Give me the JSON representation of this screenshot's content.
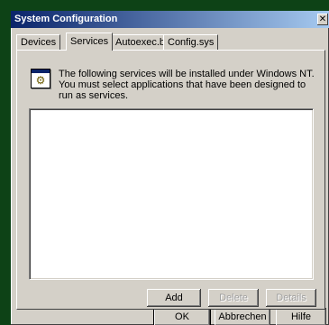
{
  "window": {
    "title": "System Configuration",
    "close_glyph": "✕"
  },
  "tabs": [
    {
      "label": "Devices"
    },
    {
      "label": "Services"
    },
    {
      "label": "Autoexec.bat"
    },
    {
      "label": "Config.sys"
    }
  ],
  "active_tab": "Services",
  "services": {
    "icon": "services-gear-icon",
    "description": "The following services will be installed under Windows NT. You must select applications that have been designed to run as services.",
    "list_items": [],
    "add_label": "Add",
    "delete_label": "Delete",
    "details_label": "Details"
  },
  "dialog_buttons": {
    "ok_label": "OK",
    "cancel_label": "Abbrechen",
    "help_label": "Hilfe"
  }
}
